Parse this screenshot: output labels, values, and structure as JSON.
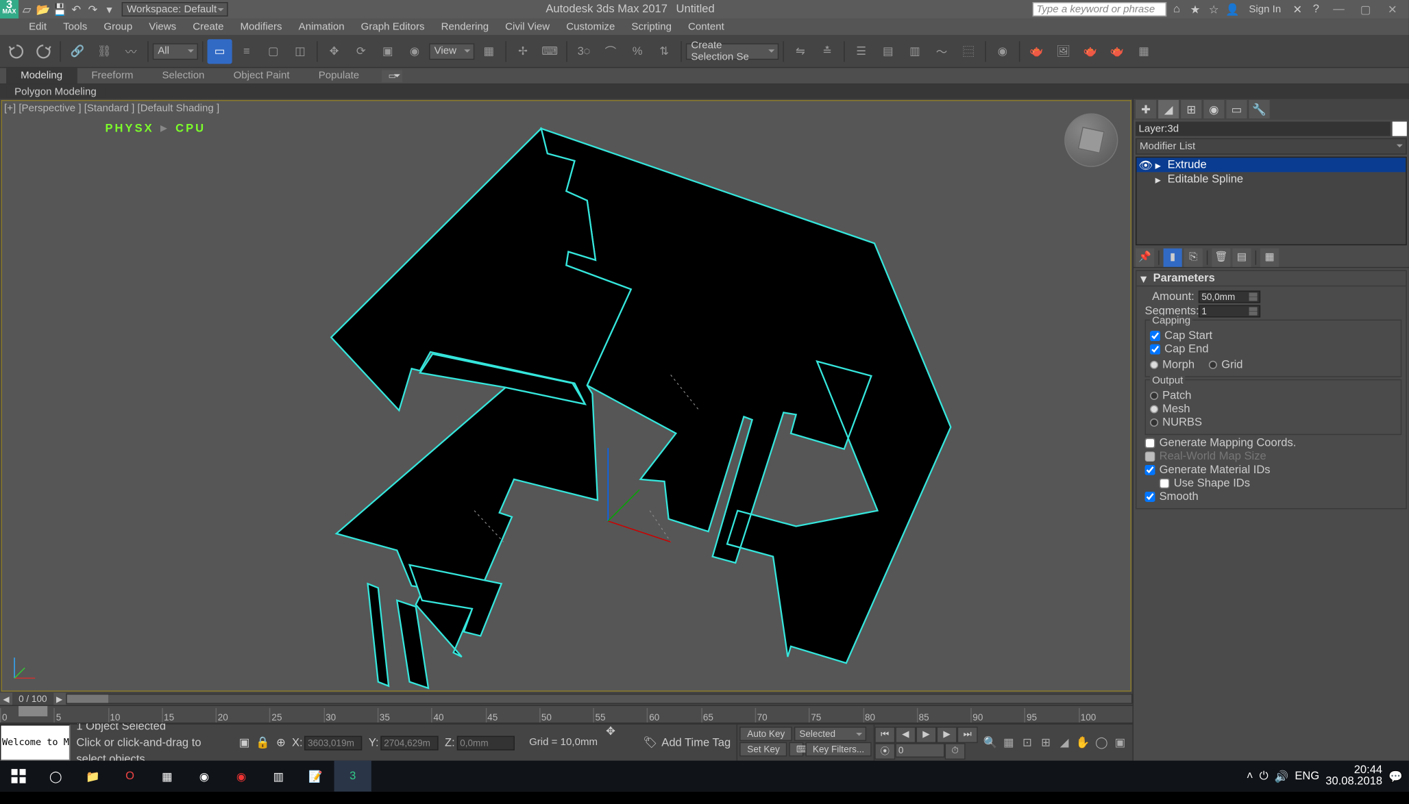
{
  "title": {
    "app": "Autodesk 3ds Max 2017",
    "doc": "Untitled",
    "workspace_label": "Workspace: Default",
    "search_placeholder": "Type a keyword or phrase",
    "sign_in": "Sign In"
  },
  "menu": [
    "Edit",
    "Tools",
    "Group",
    "Views",
    "Create",
    "Modifiers",
    "Animation",
    "Graph Editors",
    "Rendering",
    "Civil View",
    "Customize",
    "Scripting",
    "Content"
  ],
  "maintoolbar": {
    "filter_all": "All",
    "view_label": "View",
    "selset_label": "Create Selection Se"
  },
  "ribbon": {
    "tabs": [
      "Modeling",
      "Freeform",
      "Selection",
      "Object Paint",
      "Populate"
    ],
    "active": "Modeling",
    "panel": "Polygon Modeling"
  },
  "viewport": {
    "label": "[+] [Perspective ] [Standard ] [Default Shading ]",
    "physx_1": "PHYSX",
    "physx_arrow": "►",
    "physx_2": "CPU"
  },
  "timeline": {
    "range": "0 / 100",
    "ticks": [
      "0",
      "5",
      "10",
      "15",
      "20",
      "25",
      "30",
      "35",
      "40",
      "45",
      "50",
      "55",
      "60",
      "65",
      "70",
      "75",
      "80",
      "85",
      "90",
      "95",
      "100"
    ]
  },
  "status": {
    "script_prompt": "Welcome to M",
    "sel": "1 Object Selected",
    "hint": "Click or click-and-drag to select objects",
    "x": "3603,019m",
    "y": "2704,629m",
    "z": "0,0mm",
    "grid": "Grid = 10,0mm",
    "add_time_tag": "Add Time Tag",
    "auto_key": "Auto Key",
    "set_key": "Set Key",
    "selected": "Selected",
    "key_filters": "Key Filters...",
    "frame": "0"
  },
  "cmdpanel": {
    "obj_name": "Layer:3d",
    "modlist": "Modifier List",
    "stack": [
      "Extrude",
      "Editable Spline"
    ],
    "stack_selected": "Extrude",
    "rollout_params": "Parameters",
    "amount_lbl": "Amount:",
    "amount_val": "50,0mm",
    "segments_lbl": "Segments:",
    "segments_val": "1",
    "capping": "Capping",
    "cap_start": "Cap Start",
    "cap_end": "Cap End",
    "morph": "Morph",
    "grid_opt": "Grid",
    "output": "Output",
    "patch": "Patch",
    "mesh": "Mesh",
    "nurbs": "NURBS",
    "gen_map": "Generate Mapping Coords.",
    "real_world": "Real-World Map Size",
    "gen_mat": "Generate Material IDs",
    "use_shape": "Use Shape IDs",
    "smooth": "Smooth"
  },
  "taskbar": {
    "lang": "ENG",
    "time": "20:44",
    "date": "30.08.2018"
  }
}
